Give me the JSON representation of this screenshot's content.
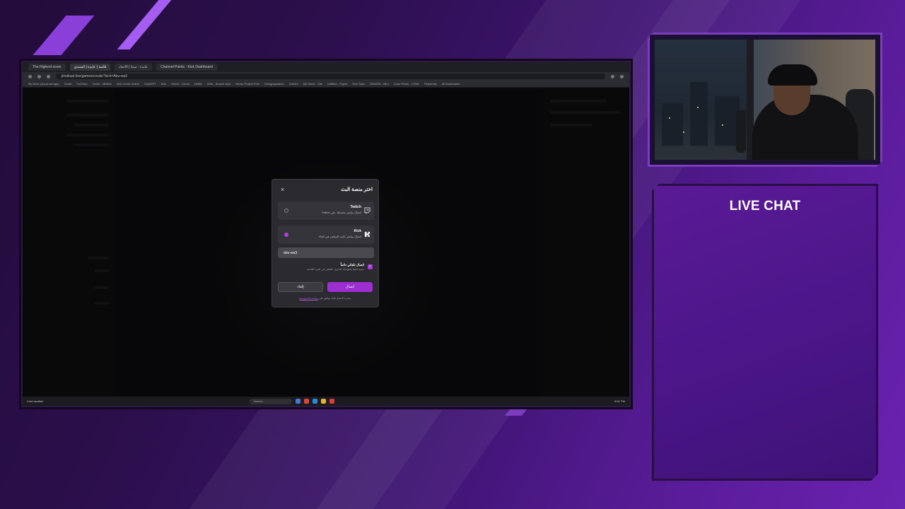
{
  "browser": {
    "tabs": [
      "The Highest score",
      "قائمة | عايدة | المنتدى",
      "عايدة - سنتا | الاتحاد",
      "Channel Points - Kick Dashboard"
    ],
    "url": "jimaliaat.live/games/create?kick=Abu-wa3",
    "bookmarks": [
      "My Drive (cloud storage)",
      "Gmail",
      "YouTube",
      "Home - MiniMo",
      "Kick Home Online",
      "ChatGPT",
      "Kick",
      "Home - Canva",
      "Netflix",
      "With - Search clips",
      "Neuro Project Free",
      "Designspiration",
      "Gemini",
      "My Home - Site",
      "Untitled - Figma",
      "Gen Topic",
      "GRADIS - Miro",
      "Color Picker - HTML",
      "Perplexity",
      "All Bookmarks"
    ]
  },
  "modal": {
    "title": "اختر منصة البث",
    "close_icon": "×",
    "options": [
      {
        "name": "Twitch",
        "desc": "اتصال مباشر بحسابك على Twitch",
        "selected": false
      },
      {
        "name": "Kick",
        "desc": "اتصال مباشر بالبث المباشر في Kick",
        "selected": true
      }
    ],
    "channel_input": "abu-wa3",
    "remember": {
      "title": "اتصال تلقائي دائماً",
      "desc": "سيتم حفظ معلوماتك للدخول التلقائي في المرة القادمة",
      "checked": true
    },
    "confirm_label": "اتصال",
    "cancel_label": "إلغاء",
    "terms_text": "بمجرد الاتصال فإنك توافق على",
    "terms_link": "سياسة الخصوصية"
  },
  "taskbar": {
    "weather": "Cold weather",
    "search_placeholder": "Search",
    "clock": "5:51 PM"
  },
  "chat": {
    "title": "LIVE CHAT"
  },
  "colors": {
    "accent": "#9b2fcf",
    "frame": "#7b3cc0"
  }
}
